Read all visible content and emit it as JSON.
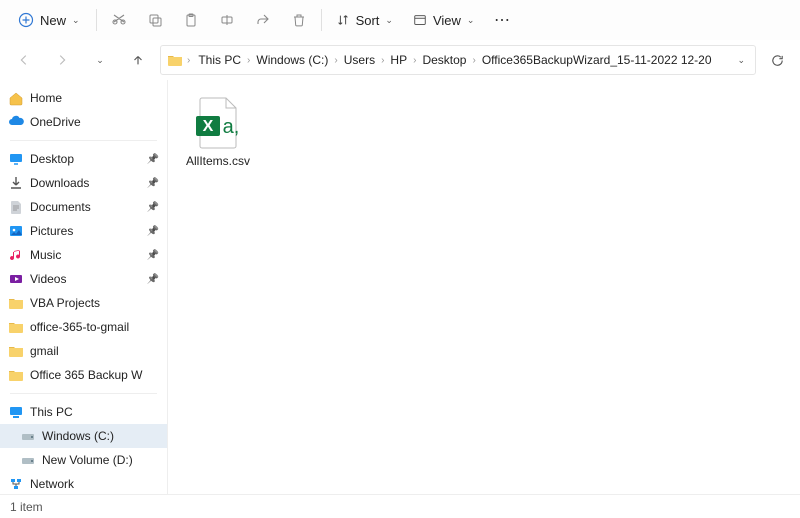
{
  "toolbar": {
    "new_label": "New",
    "sort_label": "Sort",
    "view_label": "View"
  },
  "breadcrumbs": [
    "This PC",
    "Windows (C:)",
    "Users",
    "HP",
    "Desktop",
    "Office365BackupWizard_15-11-2022 12-20"
  ],
  "sidebar": {
    "quick": [
      {
        "label": "Home",
        "icon": "home"
      },
      {
        "label": "OneDrive",
        "icon": "onedrive"
      }
    ],
    "pinned": [
      {
        "label": "Desktop",
        "icon": "desktop",
        "pinned": true
      },
      {
        "label": "Downloads",
        "icon": "downloads",
        "pinned": true
      },
      {
        "label": "Documents",
        "icon": "documents",
        "pinned": true
      },
      {
        "label": "Pictures",
        "icon": "pictures",
        "pinned": true
      },
      {
        "label": "Music",
        "icon": "music",
        "pinned": true
      },
      {
        "label": "Videos",
        "icon": "videos",
        "pinned": true
      },
      {
        "label": "VBA Projects",
        "icon": "folder",
        "pinned": false
      },
      {
        "label": "office-365-to-gmail",
        "icon": "folder",
        "pinned": false
      },
      {
        "label": "gmail",
        "icon": "folder",
        "pinned": false
      },
      {
        "label": "Office 365 Backup W",
        "icon": "folder",
        "pinned": false
      }
    ],
    "devices": [
      {
        "label": "This PC",
        "icon": "pc",
        "indent": false,
        "selected": false
      },
      {
        "label": "Windows (C:)",
        "icon": "drive",
        "indent": true,
        "selected": true
      },
      {
        "label": "New Volume (D:)",
        "icon": "drive",
        "indent": true,
        "selected": false
      },
      {
        "label": "Network",
        "icon": "network",
        "indent": false,
        "selected": false
      }
    ]
  },
  "files": [
    {
      "name": "AllItems.csv",
      "type": "csv"
    }
  ],
  "status": {
    "text": "1 item"
  }
}
